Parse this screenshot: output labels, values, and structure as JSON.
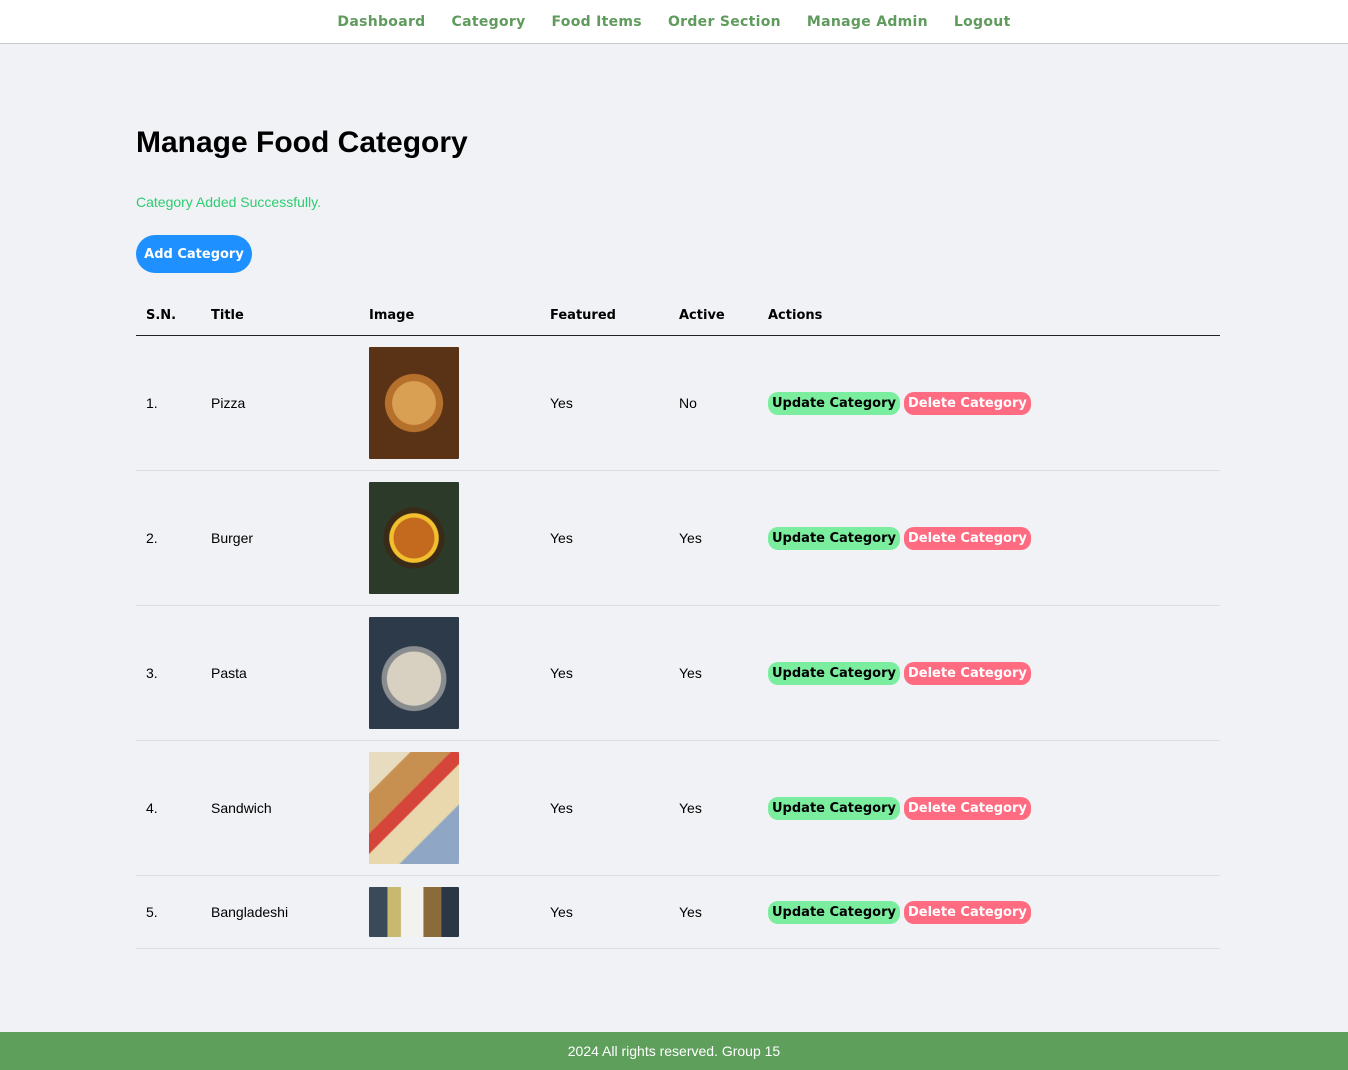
{
  "nav": {
    "items": [
      "Dashboard",
      "Category",
      "Food Items",
      "Order Section",
      "Manage Admin",
      "Logout"
    ]
  },
  "page": {
    "title": "Manage Food Category",
    "message": "Category Added Successfully.",
    "add_button": "Add Category"
  },
  "table": {
    "headers": [
      "S.N.",
      "Title",
      "Image",
      "Featured",
      "Active",
      "Actions"
    ],
    "rows": [
      {
        "sn": "1.",
        "title": "Pizza",
        "image": "pizza-image",
        "featured": "Yes",
        "active": "No"
      },
      {
        "sn": "2.",
        "title": "Burger",
        "image": "burger-image",
        "featured": "Yes",
        "active": "Yes"
      },
      {
        "sn": "3.",
        "title": "Pasta",
        "image": "pasta-image",
        "featured": "Yes",
        "active": "Yes"
      },
      {
        "sn": "4.",
        "title": "Sandwich",
        "image": "sandwich-image",
        "featured": "Yes",
        "active": "Yes"
      },
      {
        "sn": "5.",
        "title": "Bangladeshi",
        "image": "bangladeshi-image",
        "featured": "Yes",
        "active": "Yes"
      }
    ],
    "update_label": "Update Category",
    "delete_label": "Delete Category"
  },
  "footer": {
    "text": "2024 All rights reserved. Group 15"
  },
  "colors": {
    "nav_text": "#5f9b5c",
    "success": "#2ecc71",
    "primary": "#1e90ff",
    "update": "#7bed9f",
    "delete": "#ff6b81",
    "footer_bg": "#5f9f5c"
  }
}
